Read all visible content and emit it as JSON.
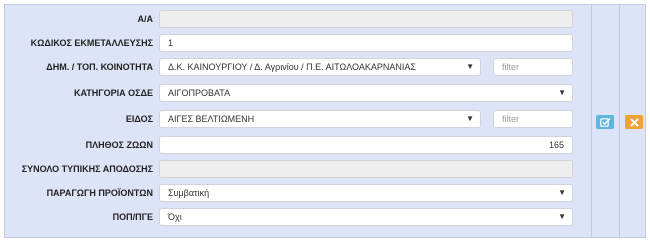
{
  "form": {
    "aa": {
      "label": "Α/Α",
      "value": ""
    },
    "farm_code": {
      "label": "ΚΩΔΙΚΟΣ ΕΚΜΕΤΑΛΛΕΥΣΗΣ",
      "value": "1"
    },
    "community": {
      "label": "ΔΗΜ. / ΤΟΠ. ΚΟΙΝΟΤΗΤΑ",
      "value": "Δ.Κ. ΚΑΙΝΟΥΡΓΙΟΥ / Δ. Αγρινίου / Π.Ε. ΑΙΤΩΛΟΑΚΑΡΝΑΝΙΑΣ",
      "filter_placeholder": "filter"
    },
    "osde_category": {
      "label": "ΚΑΤΗΓΟΡΙΑ ΟΣΔΕ",
      "value": "ΑΙΓΟΠΡΟΒΑΤΑ"
    },
    "species": {
      "label": "ΕΙΔΟΣ",
      "value": "ΑΙΓΕΣ ΒΕΛΤΙΩΜΕΝΗ",
      "filter_placeholder": "filter"
    },
    "animal_count": {
      "label": "ΠΛΗΘΟΣ ΖΩΩΝ",
      "value": "165"
    },
    "total_yield": {
      "label": "ΣΥΝΟΛΟ ΤΥΠΙΚΗΣ ΑΠΟΔΟΣΗΣ",
      "value": ""
    },
    "production": {
      "label": "ΠΑΡΑΓΩΓΗ ΠΡΟΪΟΝΤΩΝ",
      "value": "Συμβατική"
    },
    "pdo_pgi": {
      "label": "ΠΟΠ/ΠΓΕ",
      "value": "Όχι"
    }
  },
  "actions": {
    "edit_icon": "edit-check-icon",
    "delete_icon": "close-icon",
    "edit_color": "#5bb6e0",
    "delete_color": "#f0a23a"
  }
}
